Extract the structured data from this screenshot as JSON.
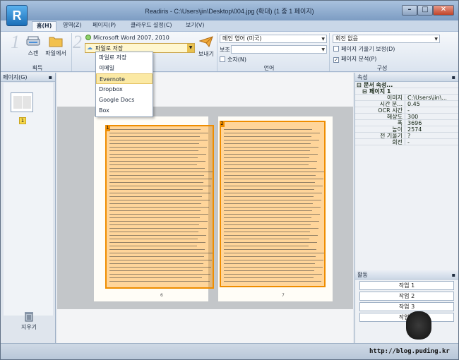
{
  "window": {
    "title": "Readiris - C:\\Users\\jin\\Desktop\\004.jpg (확대) (1 중 1 페이지)",
    "app_button": "R",
    "min_glyph": "–",
    "max_glyph": "□",
    "close_glyph": "✕"
  },
  "tabs": [
    "홈(H)",
    "영역(Z)",
    "페이지(P)",
    "클라우드 설정(C)",
    "보기(V)"
  ],
  "ribbon": {
    "step1": "1",
    "step2": "2",
    "scan_label": "스캔",
    "from_file_label": "파일에서",
    "acquire_group": "획득",
    "output_format": "Microsoft Word 2007, 2010",
    "save_target": "파일로 저장",
    "send_label": "보내기",
    "main_language": "메인  영어 (미국)",
    "sub_language_label": "보조",
    "numbers_label": "숫자(N)",
    "language_group": "언어",
    "rotation_label": "회전  없음",
    "deskew_label": "페이지 기울기 보정(D)",
    "analyze_label": "페이지 분석(P)",
    "layout_group": "구성"
  },
  "send_menu": [
    "파일로 저장",
    "이메일",
    "Evernote",
    "Dropbox",
    "Google Docs",
    "Box"
  ],
  "left_panel": {
    "title": "페이지(G)",
    "page_badge": "1",
    "delete_label": "지우기"
  },
  "document": {
    "left_zone": "1",
    "right_zone": "2",
    "left_folio": "6",
    "right_folio": "7"
  },
  "properties": {
    "title": "속성",
    "document_props": "문서 속성...",
    "page_node": "페이지 1",
    "rows": [
      {
        "k": "이미지",
        "v": "C:\\Users\\jin\\..."
      },
      {
        "k": "시간 분...",
        "v": "0.45"
      },
      {
        "k": "OCR 시간",
        "v": "-"
      },
      {
        "k": "해상도",
        "v": "300"
      },
      {
        "k": "폭",
        "v": "3696"
      },
      {
        "k": "높이",
        "v": "2574"
      },
      {
        "k": "전 기울기",
        "v": "?"
      },
      {
        "k": "회전",
        "v": "-"
      }
    ]
  },
  "activity": {
    "title": "활동",
    "jobs": [
      "작업 1",
      "작업 2",
      "작업 3",
      "작업 4"
    ]
  },
  "watermark": "http://blog.puding.kr",
  "colors": {
    "zone": "#ef8d00",
    "accent": "#1b6fb8"
  }
}
